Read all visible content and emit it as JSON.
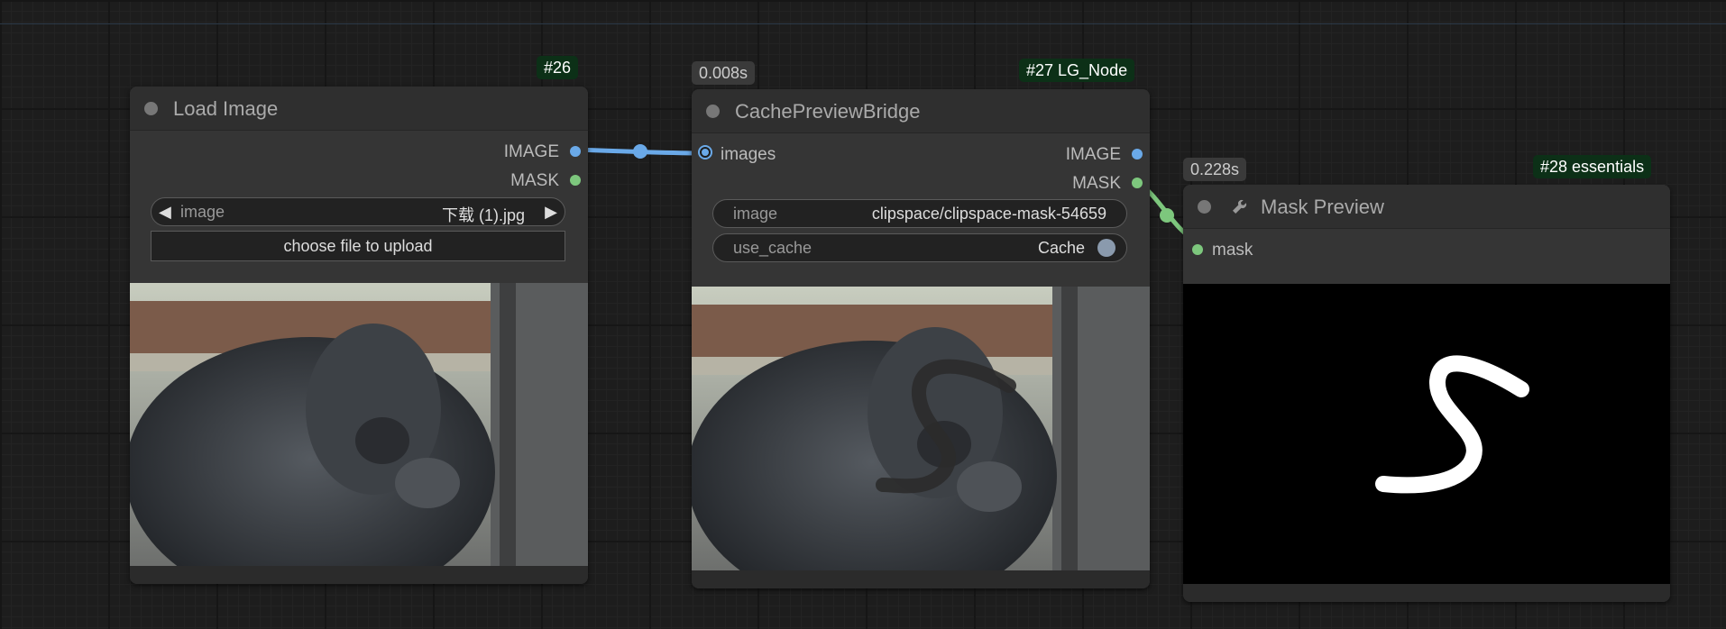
{
  "colors": {
    "canvas": "#1d1d1d",
    "node": "#353535",
    "image_link": "#6aa9e8",
    "mask_link": "#7dc77d",
    "id_badge": "#0c3017"
  },
  "nodes": {
    "load_image": {
      "badge": "#26",
      "title": "Load Image",
      "outputs": [
        "IMAGE",
        "MASK"
      ],
      "widget": {
        "label": "image",
        "value": "下载 (1).jpg",
        "left_arrow": "◀",
        "right_arrow": "▶"
      },
      "upload_button": "choose file to upload"
    },
    "cache_bridge": {
      "time": "0.008s",
      "badge": "#27 LG_Node",
      "title": "CachePreviewBridge",
      "input": "images",
      "outputs": [
        "IMAGE",
        "MASK"
      ],
      "widget_image": {
        "label": "image",
        "value": "clipspace/clipspace-mask-54659"
      },
      "widget_cache": {
        "label": "use_cache",
        "value": "Cache"
      }
    },
    "mask_preview": {
      "time": "0.228s",
      "badge": "#28 essentials",
      "title": "Mask Preview",
      "title_icon": "wrench-icon",
      "input": "mask"
    }
  }
}
